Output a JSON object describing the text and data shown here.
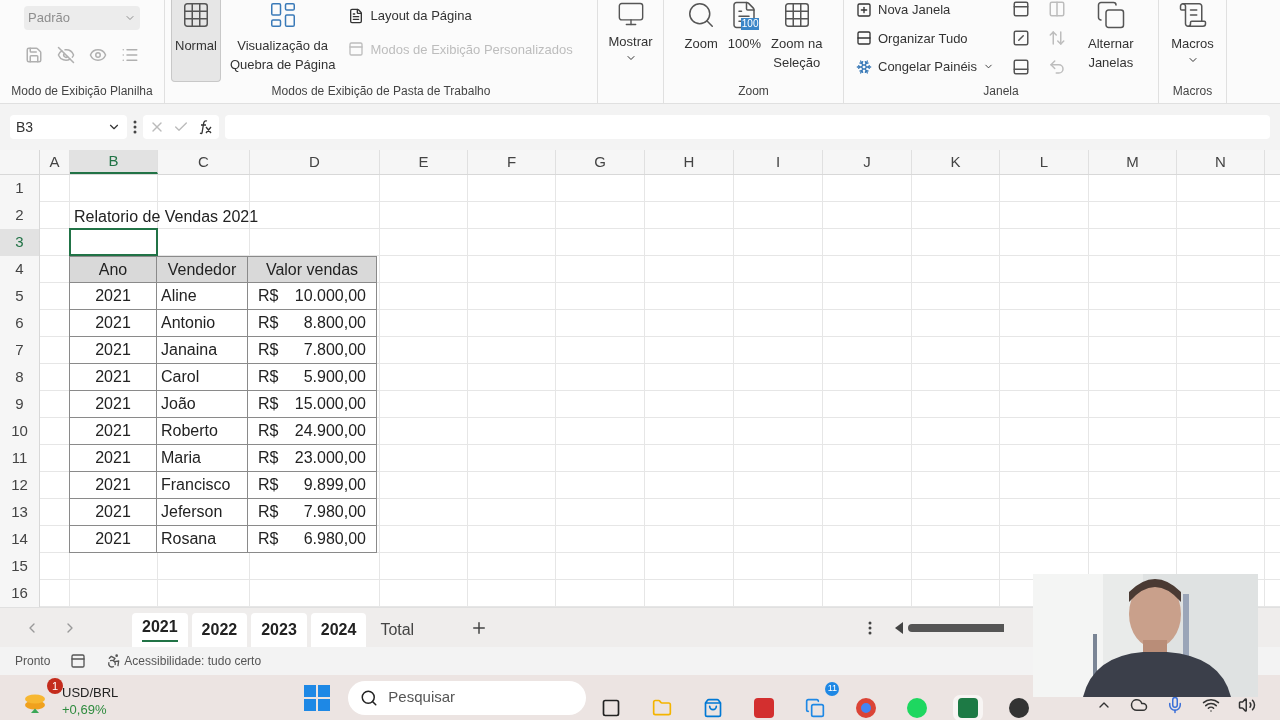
{
  "ribbon": {
    "sheet_view": {
      "label": "Modo de Exibição Planilha",
      "dropdown": {
        "value": "Padrão",
        "disabled": true
      },
      "buttons": [
        {
          "disabled": true
        },
        {
          "disabled": true
        },
        {
          "disabled": true
        },
        {
          "disabled": true
        }
      ]
    },
    "workbook_views": {
      "label": "Modos de Exibição de Pasta de Trabalho",
      "large_buttons": [
        {
          "label": "Normal",
          "selected": true
        },
        {
          "label": "Visualização da\nQuebra de Página",
          "selected": false
        }
      ],
      "small_buttons": [
        {
          "label": "Layout da Página",
          "disabled": false
        },
        {
          "label": "Modos de Exibição Personalizados",
          "disabled": true
        }
      ]
    },
    "show": {
      "label": "Mostrar"
    },
    "zoom": {
      "label": "Zoom",
      "buttons": [
        {
          "label": "Zoom"
        },
        {
          "label": "100%",
          "icon_text": "100"
        },
        {
          "label": "Zoom na\nSeleção"
        }
      ]
    },
    "window": {
      "label": "Janela",
      "small_buttons": [
        {
          "label": "Nova Janela"
        },
        {
          "label": "Organizar Tudo"
        },
        {
          "label": "Congelar Painéis"
        }
      ],
      "icon_buttons": [
        {
          "disabled": false
        },
        {
          "disabled": false
        },
        {
          "disabled": false
        },
        {
          "disabled": true
        },
        {
          "disabled": true
        },
        {
          "disabled": true
        }
      ],
      "switch_windows": "Alternar\nJanelas"
    },
    "macros": {
      "label": "Macros",
      "button": "Macros"
    }
  },
  "formula_bar": {
    "name_box": "B3"
  },
  "grid": {
    "columns": [
      {
        "label": "A",
        "selected": false
      },
      {
        "label": "B",
        "selected": true
      },
      {
        "label": "C",
        "selected": false
      },
      {
        "label": "D",
        "selected": false
      },
      {
        "label": "E",
        "selected": false
      },
      {
        "label": "F",
        "selected": false
      },
      {
        "label": "G",
        "selected": false
      },
      {
        "label": "H",
        "selected": false
      },
      {
        "label": "I",
        "selected": false
      },
      {
        "label": "J",
        "selected": false
      },
      {
        "label": "K",
        "selected": false
      },
      {
        "label": "L",
        "selected": false
      },
      {
        "label": "M",
        "selected": false
      },
      {
        "label": "N",
        "selected": false
      }
    ],
    "rows": [
      {
        "label": "1",
        "selected": false
      },
      {
        "label": "2",
        "selected": false
      },
      {
        "label": "3",
        "selected": true
      },
      {
        "label": "4",
        "selected": false
      },
      {
        "label": "5",
        "selected": false
      },
      {
        "label": "6",
        "selected": false
      },
      {
        "label": "7",
        "selected": false
      },
      {
        "label": "8",
        "selected": false
      },
      {
        "label": "9",
        "selected": false
      },
      {
        "label": "10",
        "selected": false
      },
      {
        "label": "11",
        "selected": false
      },
      {
        "label": "12",
        "selected": false
      },
      {
        "label": "13",
        "selected": false
      },
      {
        "label": "14",
        "selected": false
      },
      {
        "label": "15",
        "selected": false
      },
      {
        "label": "16",
        "selected": false
      }
    ],
    "title": "Relatorio de Vendas 2021",
    "table": {
      "columns": [
        "Ano",
        "Vendedor",
        "Valor vendas"
      ],
      "rows": [
        {
          "year": "2021",
          "seller": "Aline",
          "currency": "R$",
          "amount": "10.000,00"
        },
        {
          "year": "2021",
          "seller": "Antonio",
          "currency": "R$",
          "amount": "8.800,00"
        },
        {
          "year": "2021",
          "seller": "Janaina",
          "currency": "R$",
          "amount": "7.800,00"
        },
        {
          "year": "2021",
          "seller": "Carol",
          "currency": "R$",
          "amount": "5.900,00"
        },
        {
          "year": "2021",
          "seller": "João",
          "currency": "R$",
          "amount": "15.000,00"
        },
        {
          "year": "2021",
          "seller": "Roberto",
          "currency": "R$",
          "amount": "24.900,00"
        },
        {
          "year": "2021",
          "seller": "Maria",
          "currency": "R$",
          "amount": "23.000,00"
        },
        {
          "year": "2021",
          "seller": "Francisco",
          "currency": "R$",
          "amount": "9.899,00"
        },
        {
          "year": "2021",
          "seller": "Jeferson",
          "currency": "R$",
          "amount": "7.980,00"
        },
        {
          "year": "2021",
          "seller": "Rosana",
          "currency": "R$",
          "amount": "6.980,00"
        }
      ]
    }
  },
  "sheet_tabs": [
    {
      "label": "2021",
      "selected": true,
      "active": true
    },
    {
      "label": "2022",
      "selected": true,
      "active": false
    },
    {
      "label": "2023",
      "selected": true,
      "active": false
    },
    {
      "label": "2024",
      "selected": true,
      "active": false
    },
    {
      "label": "Total",
      "selected": false,
      "active": false
    }
  ],
  "status_bar": {
    "status": "Pronto",
    "accessibility": "Acessibilidade: tudo certo"
  },
  "taskbar": {
    "widget": {
      "ticker": "USD/BRL",
      "change": "+0,69%",
      "badge": "1"
    },
    "search_placeholder": "Pesquisar",
    "apps": [
      {
        "active": false
      },
      {
        "active": false
      },
      {
        "active": false
      },
      {
        "active": false
      },
      {
        "active": false,
        "badge": "11"
      },
      {
        "active": false
      },
      {
        "active": false
      },
      {
        "active": true
      },
      {
        "active": false
      }
    ]
  }
}
